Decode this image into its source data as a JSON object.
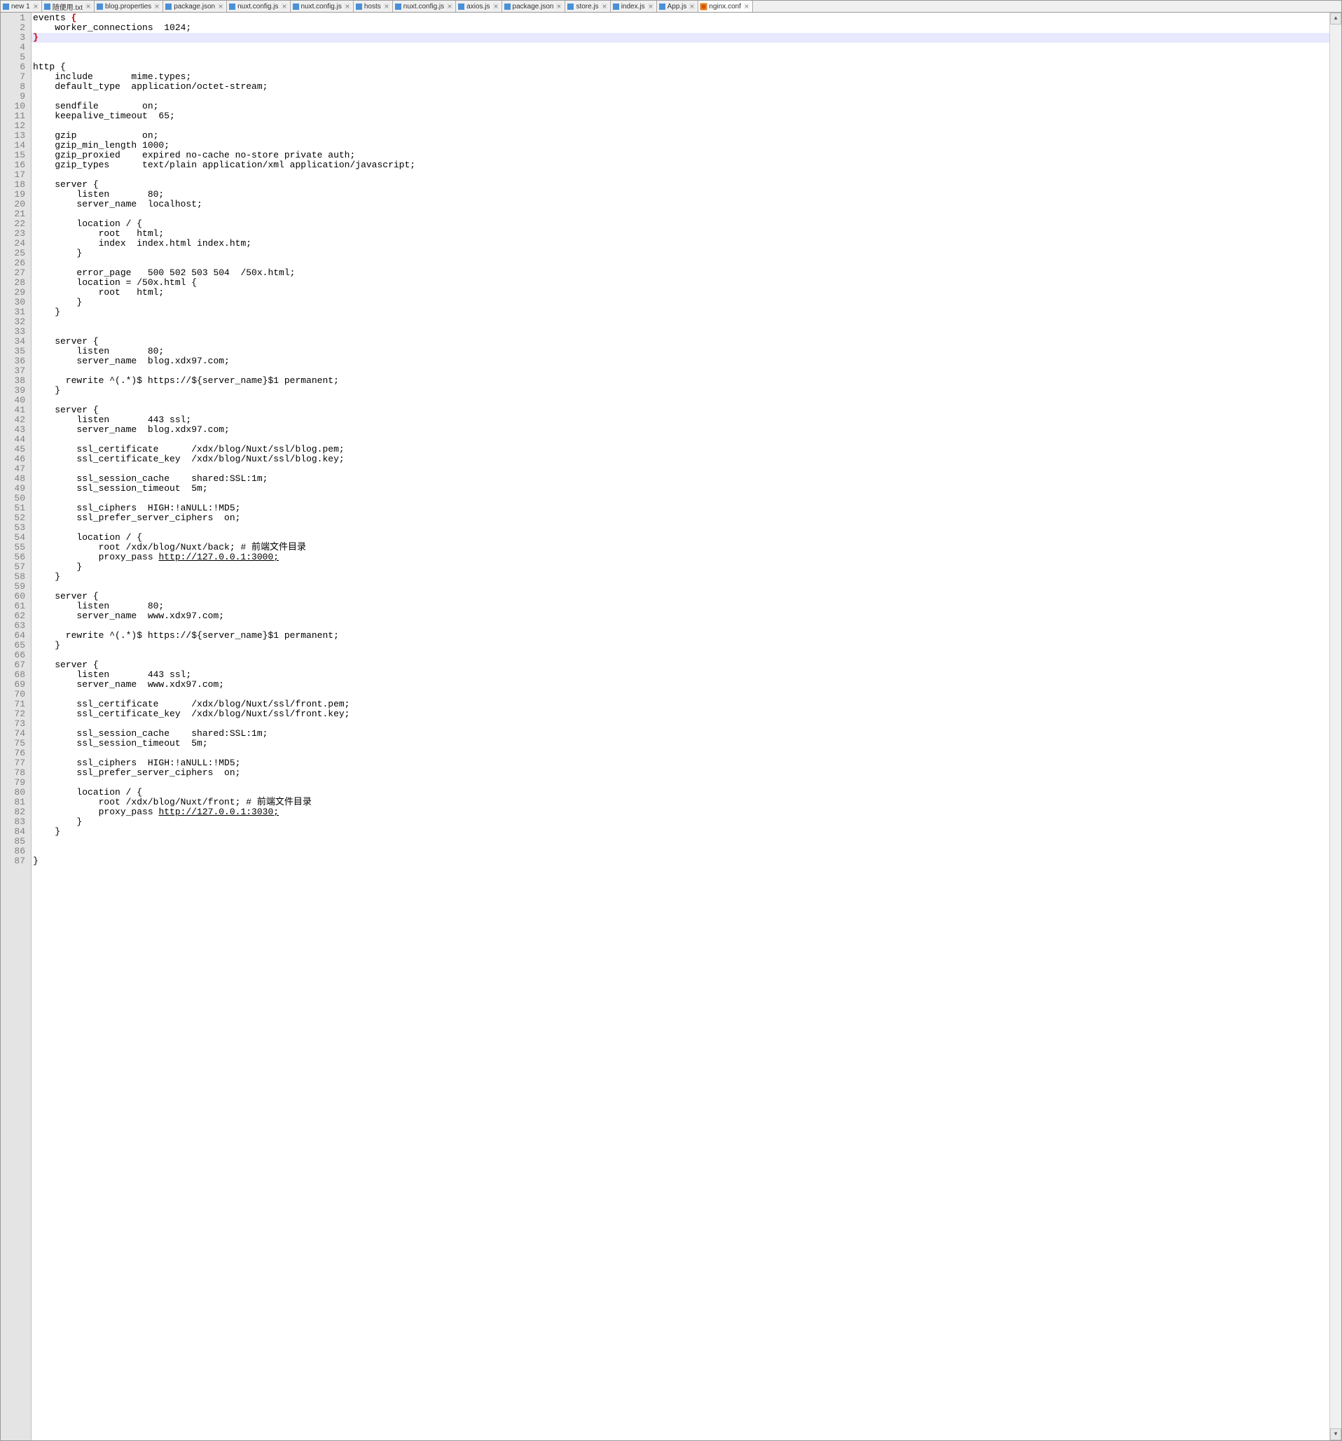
{
  "tabs": [
    {
      "label": "new 1",
      "icon": "blue"
    },
    {
      "label": "随便用.txt",
      "icon": "blue"
    },
    {
      "label": "blog.properties",
      "icon": "blue"
    },
    {
      "label": "package.json",
      "icon": "blue"
    },
    {
      "label": "nuxt.config.js",
      "icon": "blue"
    },
    {
      "label": "nuxt.config.js",
      "icon": "blue"
    },
    {
      "label": "hosts",
      "icon": "blue"
    },
    {
      "label": "nuxt.config.js",
      "icon": "blue"
    },
    {
      "label": "axios.js",
      "icon": "blue"
    },
    {
      "label": "package.json",
      "icon": "blue"
    },
    {
      "label": "store.js",
      "icon": "blue"
    },
    {
      "label": "index.js",
      "icon": "blue"
    },
    {
      "label": "App.js",
      "icon": "blue"
    },
    {
      "label": "nginx.conf",
      "icon": "orange",
      "active": true
    }
  ],
  "current_line": 3,
  "lines": [
    {
      "n": 1,
      "segs": [
        {
          "t": "events "
        },
        {
          "t": "{",
          "c": "brace-red"
        }
      ]
    },
    {
      "n": 2,
      "segs": [
        {
          "t": "    worker_connections  1024;"
        }
      ]
    },
    {
      "n": 3,
      "segs": [
        {
          "t": "}",
          "c": "brace-red"
        }
      ]
    },
    {
      "n": 4,
      "segs": []
    },
    {
      "n": 5,
      "segs": []
    },
    {
      "n": 6,
      "segs": [
        {
          "t": "http {"
        }
      ]
    },
    {
      "n": 7,
      "segs": [
        {
          "t": "    include       mime.types;"
        }
      ]
    },
    {
      "n": 8,
      "segs": [
        {
          "t": "    default_type  application/octet-stream;"
        }
      ]
    },
    {
      "n": 9,
      "segs": []
    },
    {
      "n": 10,
      "segs": [
        {
          "t": "    sendfile        on;"
        }
      ]
    },
    {
      "n": 11,
      "segs": [
        {
          "t": "    keepalive_timeout  65;"
        }
      ]
    },
    {
      "n": 12,
      "segs": []
    },
    {
      "n": 13,
      "segs": [
        {
          "t": "    gzip            on;"
        }
      ]
    },
    {
      "n": 14,
      "segs": [
        {
          "t": "    gzip_min_length 1000;"
        }
      ]
    },
    {
      "n": 15,
      "segs": [
        {
          "t": "    gzip_proxied    expired no-cache no-store private auth;"
        }
      ]
    },
    {
      "n": 16,
      "segs": [
        {
          "t": "    gzip_types      text/plain application/xml application/javascript;"
        }
      ]
    },
    {
      "n": 17,
      "segs": []
    },
    {
      "n": 18,
      "segs": [
        {
          "t": "    server {"
        }
      ]
    },
    {
      "n": 19,
      "segs": [
        {
          "t": "        listen       80;"
        }
      ]
    },
    {
      "n": 20,
      "segs": [
        {
          "t": "        server_name  localhost;"
        }
      ]
    },
    {
      "n": 21,
      "segs": []
    },
    {
      "n": 22,
      "segs": [
        {
          "t": "        location / {"
        }
      ]
    },
    {
      "n": 23,
      "segs": [
        {
          "t": "            root   html;"
        }
      ]
    },
    {
      "n": 24,
      "segs": [
        {
          "t": "            index  index.html index.htm;"
        }
      ]
    },
    {
      "n": 25,
      "segs": [
        {
          "t": "        }"
        }
      ]
    },
    {
      "n": 26,
      "segs": []
    },
    {
      "n": 27,
      "segs": [
        {
          "t": "        error_page   500 502 503 504  /50x.html;"
        }
      ]
    },
    {
      "n": 28,
      "segs": [
        {
          "t": "        location = /50x.html {"
        }
      ]
    },
    {
      "n": 29,
      "segs": [
        {
          "t": "            root   html;"
        }
      ]
    },
    {
      "n": 30,
      "segs": [
        {
          "t": "        }"
        }
      ]
    },
    {
      "n": 31,
      "segs": [
        {
          "t": "    }"
        }
      ]
    },
    {
      "n": 32,
      "segs": []
    },
    {
      "n": 33,
      "segs": []
    },
    {
      "n": 34,
      "segs": [
        {
          "t": "    server {"
        }
      ]
    },
    {
      "n": 35,
      "segs": [
        {
          "t": "        listen       80;"
        }
      ]
    },
    {
      "n": 36,
      "segs": [
        {
          "t": "        server_name  blog.xdx97.com;"
        }
      ]
    },
    {
      "n": 37,
      "segs": []
    },
    {
      "n": 38,
      "segs": [
        {
          "t": "      rewrite ^(.*)$ https://${server_name}$1 permanent;"
        }
      ]
    },
    {
      "n": 39,
      "segs": [
        {
          "t": "    }"
        }
      ]
    },
    {
      "n": 40,
      "segs": []
    },
    {
      "n": 41,
      "segs": [
        {
          "t": "    server {"
        }
      ]
    },
    {
      "n": 42,
      "segs": [
        {
          "t": "        listen       443 ssl;"
        }
      ]
    },
    {
      "n": 43,
      "segs": [
        {
          "t": "        server_name  blog.xdx97.com;"
        }
      ]
    },
    {
      "n": 44,
      "segs": []
    },
    {
      "n": 45,
      "segs": [
        {
          "t": "        ssl_certificate      /xdx/blog/Nuxt/ssl/blog.pem;"
        }
      ]
    },
    {
      "n": 46,
      "segs": [
        {
          "t": "        ssl_certificate_key  /xdx/blog/Nuxt/ssl/blog.key;"
        }
      ]
    },
    {
      "n": 47,
      "segs": []
    },
    {
      "n": 48,
      "segs": [
        {
          "t": "        ssl_session_cache    shared:SSL:1m;"
        }
      ]
    },
    {
      "n": 49,
      "segs": [
        {
          "t": "        ssl_session_timeout  5m;"
        }
      ]
    },
    {
      "n": 50,
      "segs": []
    },
    {
      "n": 51,
      "segs": [
        {
          "t": "        ssl_ciphers  HIGH:!aNULL:!MD5;"
        }
      ]
    },
    {
      "n": 52,
      "segs": [
        {
          "t": "        ssl_prefer_server_ciphers  on;"
        }
      ]
    },
    {
      "n": 53,
      "segs": []
    },
    {
      "n": 54,
      "segs": [
        {
          "t": "        location / {"
        }
      ]
    },
    {
      "n": 55,
      "segs": [
        {
          "t": "            root /xdx/blog/Nuxt/back; # 前端文件目录"
        }
      ]
    },
    {
      "n": 56,
      "segs": [
        {
          "t": "            proxy_pass "
        },
        {
          "t": "http://127.0.0.1:3000;",
          "c": "underline"
        }
      ]
    },
    {
      "n": 57,
      "segs": [
        {
          "t": "        }"
        }
      ]
    },
    {
      "n": 58,
      "segs": [
        {
          "t": "    }"
        }
      ]
    },
    {
      "n": 59,
      "segs": []
    },
    {
      "n": 60,
      "segs": [
        {
          "t": "    server {"
        }
      ]
    },
    {
      "n": 61,
      "segs": [
        {
          "t": "        listen       80;"
        }
      ]
    },
    {
      "n": 62,
      "segs": [
        {
          "t": "        server_name  www.xdx97.com;"
        }
      ]
    },
    {
      "n": 63,
      "segs": []
    },
    {
      "n": 64,
      "segs": [
        {
          "t": "      rewrite ^(.*)$ https://${server_name}$1 permanent;"
        }
      ]
    },
    {
      "n": 65,
      "segs": [
        {
          "t": "    }"
        }
      ]
    },
    {
      "n": 66,
      "segs": []
    },
    {
      "n": 67,
      "segs": [
        {
          "t": "    server {"
        }
      ]
    },
    {
      "n": 68,
      "segs": [
        {
          "t": "        listen       443 ssl;"
        }
      ]
    },
    {
      "n": 69,
      "segs": [
        {
          "t": "        server_name  www.xdx97.com;"
        }
      ]
    },
    {
      "n": 70,
      "segs": []
    },
    {
      "n": 71,
      "segs": [
        {
          "t": "        ssl_certificate      /xdx/blog/Nuxt/ssl/front.pem;"
        }
      ]
    },
    {
      "n": 72,
      "segs": [
        {
          "t": "        ssl_certificate_key  /xdx/blog/Nuxt/ssl/front.key;"
        }
      ]
    },
    {
      "n": 73,
      "segs": []
    },
    {
      "n": 74,
      "segs": [
        {
          "t": "        ssl_session_cache    shared:SSL:1m;"
        }
      ]
    },
    {
      "n": 75,
      "segs": [
        {
          "t": "        ssl_session_timeout  5m;"
        }
      ]
    },
    {
      "n": 76,
      "segs": []
    },
    {
      "n": 77,
      "segs": [
        {
          "t": "        ssl_ciphers  HIGH:!aNULL:!MD5;"
        }
      ]
    },
    {
      "n": 78,
      "segs": [
        {
          "t": "        ssl_prefer_server_ciphers  on;"
        }
      ]
    },
    {
      "n": 79,
      "segs": []
    },
    {
      "n": 80,
      "segs": [
        {
          "t": "        location / {"
        }
      ]
    },
    {
      "n": 81,
      "segs": [
        {
          "t": "            root /xdx/blog/Nuxt/front; # 前端文件目录"
        }
      ]
    },
    {
      "n": 82,
      "segs": [
        {
          "t": "            proxy_pass "
        },
        {
          "t": "http://127.0.0.1:3030;",
          "c": "underline"
        }
      ]
    },
    {
      "n": 83,
      "segs": [
        {
          "t": "        }"
        }
      ]
    },
    {
      "n": 84,
      "segs": [
        {
          "t": "    }"
        }
      ]
    },
    {
      "n": 85,
      "segs": []
    },
    {
      "n": 86,
      "segs": []
    },
    {
      "n": 87,
      "segs": [
        {
          "t": "}"
        }
      ]
    }
  ]
}
